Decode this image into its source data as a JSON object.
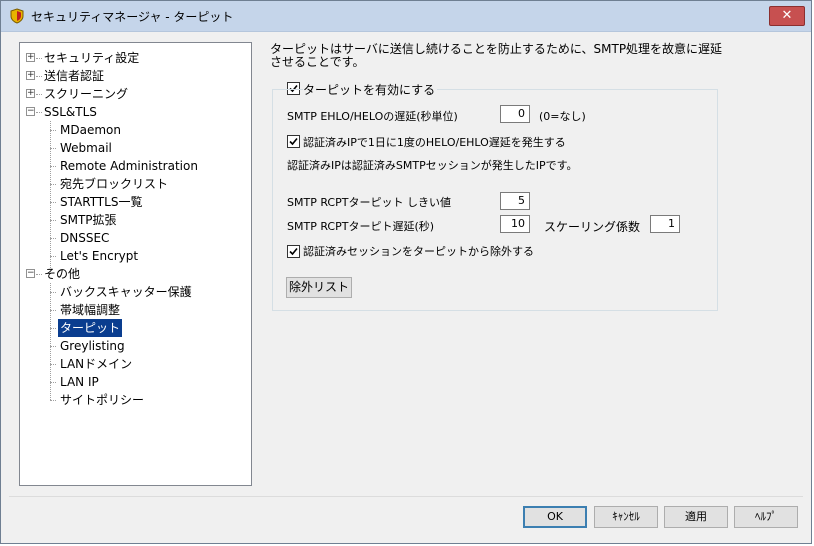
{
  "window": {
    "title": "セキュリティマネージャ - ターピット",
    "close_label": "✕"
  },
  "tree": {
    "items": [
      {
        "label": "セキュリティ設定"
      },
      {
        "label": "送信者認証"
      },
      {
        "label": "スクリーニング"
      },
      {
        "label": "SSL&TLS"
      },
      {
        "label": "MDaemon"
      },
      {
        "label": "Webmail"
      },
      {
        "label": "Remote Administration"
      },
      {
        "label": "宛先ブロックリスト"
      },
      {
        "label": "STARTTLS一覧"
      },
      {
        "label": "SMTP拡張"
      },
      {
        "label": "DNSSEC"
      },
      {
        "label": "Let's Encrypt"
      },
      {
        "label": "その他"
      },
      {
        "label": "バックスキャッター保護"
      },
      {
        "label": "帯域幅調整"
      },
      {
        "label": "ターピット"
      },
      {
        "label": "Greylisting"
      },
      {
        "label": "LANドメイン"
      },
      {
        "label": "LAN IP"
      },
      {
        "label": "サイトポリシー"
      }
    ],
    "selected": "ターピット"
  },
  "content": {
    "description_line1": "ターピットはサーバに送信し続けることを防止するために、SMTP処理を故意に遅延",
    "description_line2": "させることです。",
    "enable_tarpit": {
      "label": "ターピットを有効にする",
      "checked": true
    },
    "ehlo_delay_label": "SMTP EHLO/HELOの遅延(秒単位)",
    "ehlo_delay_value": "0",
    "ehlo_delay_hint": "(0=なし)",
    "auth_ip_delay": {
      "label": "認証済みIPで1日に1度のHELO/EHLO遅延を発生する",
      "checked": true
    },
    "auth_ip_note": "認証済みIPは認証済みSMTPセッションが発生したIPです。",
    "rcpt_threshold_label": "SMTP RCPTターピット しきい値",
    "rcpt_threshold_value": "5",
    "rcpt_delay_label": "SMTP RCPTターピト遅延(秒)",
    "rcpt_delay_value": "10",
    "scaling_label": "スケーリング係数",
    "scaling_value": "1",
    "exclude_auth": {
      "label": "認証済みセッションをターピットから除外する",
      "checked": true
    },
    "exclusion_list_button": "除外リスト"
  },
  "footer": {
    "ok": "OK",
    "cancel": "ｷｬﾝｾﾙ",
    "apply": "適用",
    "help": "ﾍﾙﾌﾟ"
  },
  "colors": {
    "selection": "#0a3d8f",
    "titlebar": "#c5d5ea",
    "close": "#c75050"
  }
}
